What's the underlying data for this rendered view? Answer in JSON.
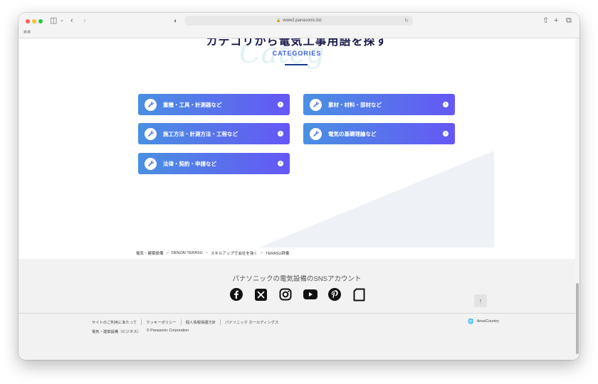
{
  "browser": {
    "url": "www2.panasonic.biz",
    "icons": [
      "sidebar-icon",
      "chevron-down-icon",
      "back-icon",
      "forward-icon",
      "shield-half-icon",
      "lock-icon",
      "reload-icon",
      "share-icon",
      "new-tab-icon",
      "tabs-overview-icon",
      "extension-icon"
    ]
  },
  "section": {
    "heading_partial": "カテゴリから電気工事用語を探す",
    "script_text": "Categ",
    "label": "CATEGORIES"
  },
  "categories": [
    {
      "label": "重機・工具・計測器など",
      "icon": "wrench-icon"
    },
    {
      "label": "素材・材料・部材など",
      "icon": "wrench-icon"
    },
    {
      "label": "施工方法・計測方法・工程など",
      "icon": "wrench-icon"
    },
    {
      "label": "電気の基礎理論など",
      "icon": "wrench-icon"
    },
    {
      "label": "法律・契約・申請など",
      "icon": "wrench-icon"
    }
  ],
  "breadcrumb": [
    "電気・建築設備",
    "DENZAI TERASU",
    "スキルアップで会社を強く",
    "TERASU辞書"
  ],
  "footer": {
    "sns_title": "パナソニックの電気設備のSNSアカウント",
    "sns": [
      "facebook-icon",
      "x-icon",
      "instagram-icon",
      "youtube-icon",
      "pinterest-icon",
      "note-icon"
    ],
    "links": [
      "サイトのご利用にあたって",
      "クッキーポリシー",
      "個人情報保護方針",
      "パナソニック ホールディングス"
    ],
    "bottom_left": "電気・建築設備（ビジネス）",
    "copyright": "© Panasonic Corporation",
    "area": "Area/Country"
  },
  "colors": {
    "button_gradient_start": "#4a90e2",
    "button_gradient_end": "#6557f5",
    "accent": "#3f5fe0"
  }
}
